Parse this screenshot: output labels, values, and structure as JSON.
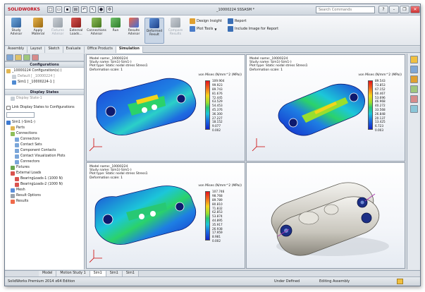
{
  "app": {
    "logo": "SOLIDWORKS",
    "document_title": "_10000224 SSSASM *",
    "search_placeholder": "Search Commands",
    "window_buttons": [
      "?",
      "-",
      "❐",
      "✕"
    ]
  },
  "ribbon": {
    "buttons": [
      {
        "label": "Study Advisor"
      },
      {
        "label": "Apply Material"
      },
      {
        "label": "Fixtures Advisor"
      },
      {
        "label": "External Loads..."
      },
      {
        "label": "Connections Advisor"
      },
      {
        "label": "Run"
      },
      {
        "label": "Results Advisor"
      },
      {
        "label": "Deformed Result"
      },
      {
        "label": "Compare Results"
      }
    ],
    "small": {
      "design_insight": "Design Insight",
      "plot_tools": "Plot Tools",
      "report": "Report",
      "include_image": "Include Image for Report"
    }
  },
  "command_tabs": [
    "Assembly",
    "Layout",
    "Sketch",
    "Evaluate",
    "Office Products",
    "Simulation"
  ],
  "tree": {
    "configurations_header": "Configurations",
    "config_root": "_10000224 Configuration(s) (",
    "config_default": "Default [ _10000224 ]",
    "config_sim1": "Sim1 [ _10000224-1 ]",
    "display_states_header": "Display States",
    "display_state_1": "Display State-1",
    "link_display_states": "Link Display States to Configurations",
    "sim_root": "Sim1 (-Sim1-)",
    "items": [
      {
        "label": "Parts",
        "indent": 1
      },
      {
        "label": "Connections",
        "indent": 1
      },
      {
        "label": "Connectors",
        "indent": 2
      },
      {
        "label": "Contact Sets",
        "indent": 2
      },
      {
        "label": "Component Contacts",
        "indent": 2
      },
      {
        "label": "Contact Visualization Plots",
        "indent": 2
      },
      {
        "label": "Connectors",
        "indent": 2
      },
      {
        "label": "Fixtures",
        "indent": 1
      },
      {
        "label": "External Loads",
        "indent": 1
      },
      {
        "label": "BearingLoads-1 (1000 N)",
        "indent": 2
      },
      {
        "label": "BearingLoads-2 (1000 N)",
        "indent": 2
      },
      {
        "label": "Mesh",
        "indent": 1
      },
      {
        "label": "Result Options",
        "indent": 1
      },
      {
        "label": "Results",
        "indent": 1
      }
    ]
  },
  "viewports": {
    "tl": {
      "model_name": "Model name:_10000224",
      "study_name": "Study name: Sim1(-Sim1-)",
      "plot_type": "Plot type: Static nodal stress Stress1",
      "deformation": "Deformation scale: 1",
      "unit": "von Mises (N/mm^2 (MPa))",
      "legend": [
        "109.904",
        "99.923",
        "89.743",
        "81.676",
        "72.445",
        "63.529",
        "54.453",
        "45.376",
        "36.300",
        "27.227",
        "18.152",
        "9.077",
        "0.002"
      ]
    },
    "tr": {
      "model_name": "Model name:_10000224",
      "study_name": "Study name: Sim1(-Sim1-)",
      "plot_type": "Plot type: Static nodal stress Stress1",
      "deformation": "Deformation scale: 1",
      "unit": "von Mises (N/mm^2 (MPa))",
      "legend": [
        "89.543",
        "73.853",
        "67.152",
        "60.467",
        "53.696",
        "46.968",
        "40.272",
        "33.568",
        "26.848",
        "20.137",
        "13.425",
        "6.723",
        "0.003"
      ]
    },
    "bl": {
      "model_name": "Model name:_10000224",
      "study_name": "Study name: Sim1(-Sim1-)",
      "plot_type": "Plot type: Static nodal stress Stress1",
      "deformation": "Deformation scale: 1",
      "unit": "von Mises (N/mm^2 (MPa))",
      "legend": [
        "107.746",
        "98.768",
        "89.789",
        "80.810",
        "71.832",
        "62.853",
        "53.874",
        "44.895",
        "35.917",
        "26.938",
        "17.959",
        "8.981",
        "0.002"
      ]
    }
  },
  "bottom_tabs": [
    "Model",
    "Motion Study 1",
    "Sim1",
    "Sim1",
    "Sim1"
  ],
  "status": {
    "edition": "SolidWorks Premium 2014 x64 Edition",
    "state": "Under Defined",
    "mode": "Editing Assembly"
  },
  "colors": {
    "accent": "#c1121f",
    "stress_max": "#e8141b",
    "stress_min": "#1424c9"
  }
}
